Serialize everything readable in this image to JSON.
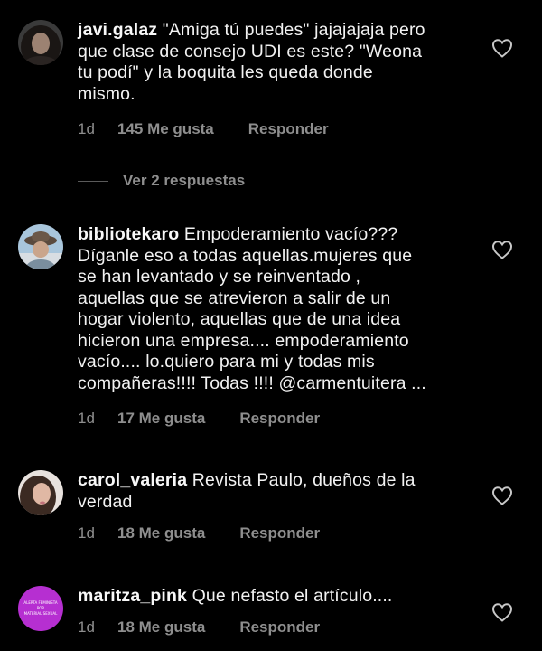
{
  "comments": [
    {
      "username": "javi.galaz",
      "text": " \"Amiga tú puedes\" jajajajaja pero\nque clase de consejo UDI es este? \"Weona\ntu podí\" y la boquita les queda donde\nmismo.",
      "time": "1d",
      "likes": "145 Me gusta",
      "reply": "Responder",
      "avatar": "dark-hair-woman-photo"
    },
    {
      "username": "bibliotekaro",
      "text": " Empoderamiento vacío???\nDíganle eso a todas aquellas.mujeres que\nse han levantado  y se reinventado ,\naquellas que se atrevieron a salir de un\nhogar violento, aquellas que de una idea\nhicieron una empresa.... empoderamiento\nvacío.... lo.quiero para mi y todas mis\ncompañeras!!!! Todas !!!! @carmentuitera ...",
      "time": "1d",
      "likes": "17 Me gusta",
      "reply": "Responder",
      "avatar": "hat-woman-sky-photo"
    },
    {
      "username": "carol_valeria",
      "text": " Revista Paulo, dueños de la\nverdad",
      "time": "1d",
      "likes": "18 Me gusta",
      "reply": "Responder",
      "avatar": "woman-selfie-photo"
    },
    {
      "username": "maritza_pink",
      "text": " Que nefasto el artículo....",
      "time": "1d",
      "likes": "18 Me gusta",
      "reply": "Responder",
      "avatar": "purple-logo"
    }
  ],
  "view_replies": "Ver 2 respuestas",
  "avatar_logo_text": [
    "ALERTA FEMINISTA",
    "POR",
    "MATERIAL SEXUAL"
  ],
  "colors": {
    "background": "#000000",
    "text": "#f2f2f2",
    "secondary": "#8e8e8e",
    "logo_purple": "#b62fd1"
  }
}
